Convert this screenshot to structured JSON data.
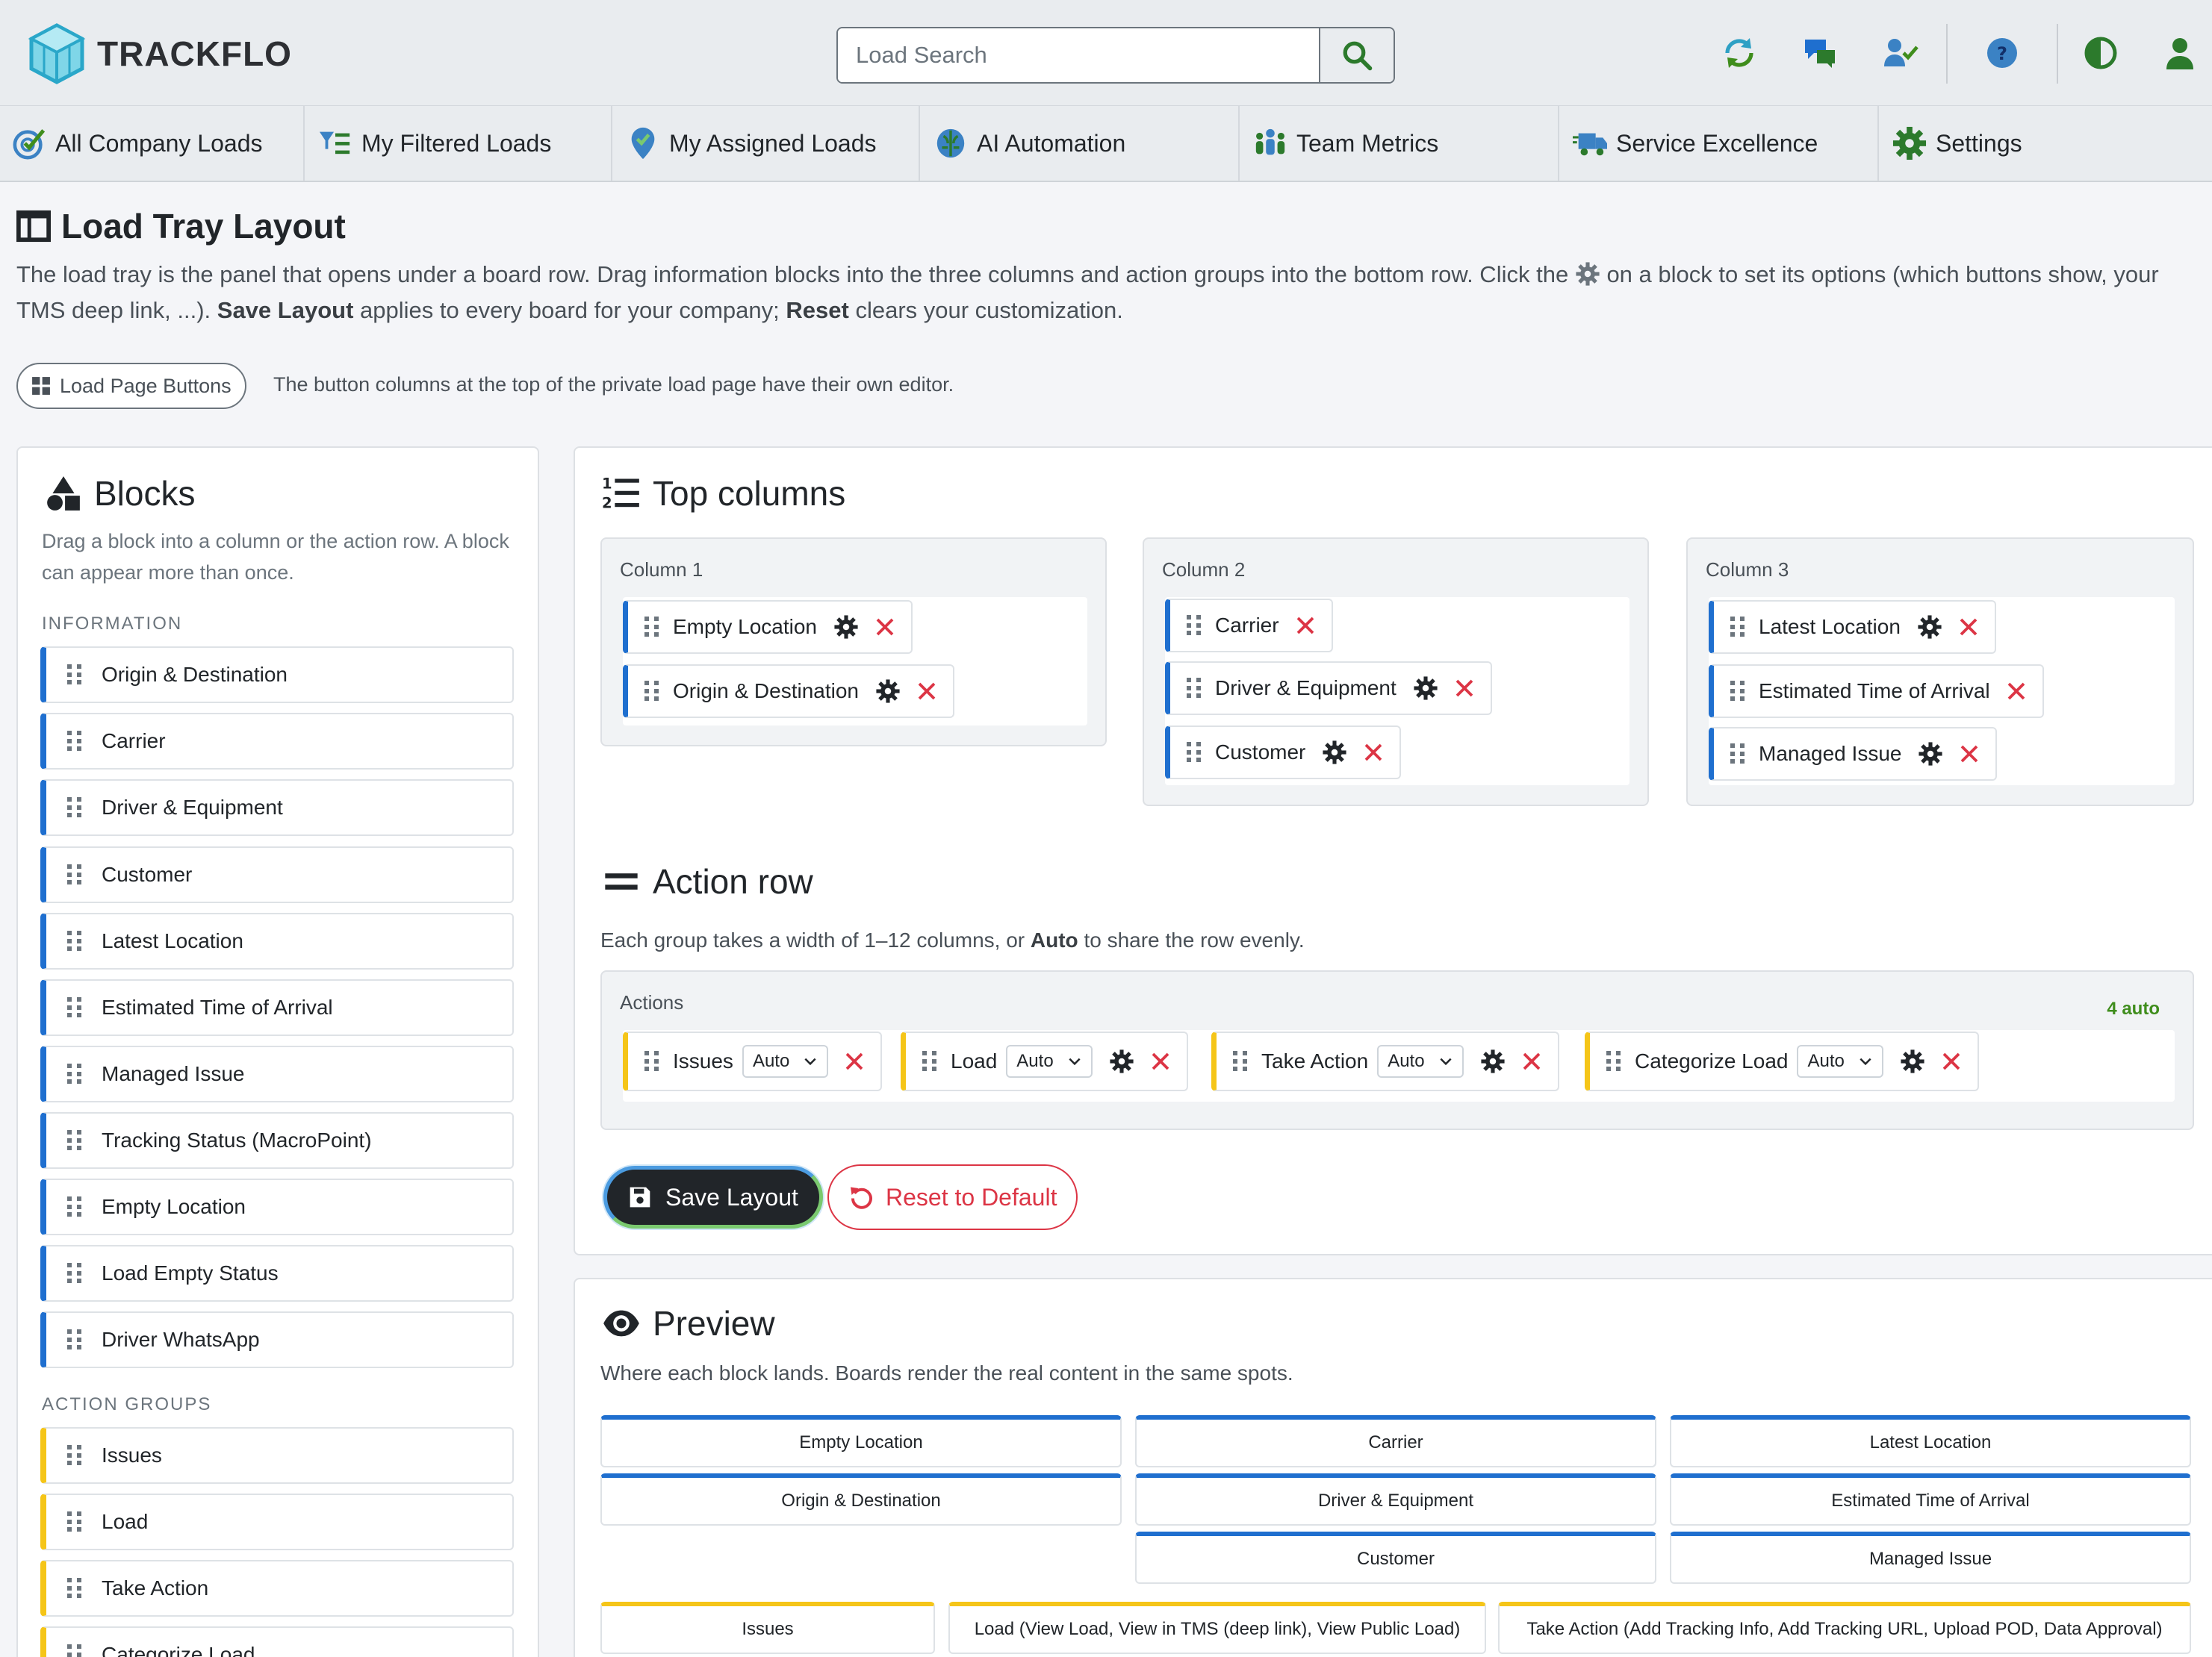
{
  "app": {
    "name": "TRACKFLO"
  },
  "search": {
    "placeholder": "Load Search"
  },
  "header_icons": [
    "refresh-icon",
    "chat-icon",
    "user-check-icon",
    "help-icon",
    "contrast-icon",
    "user-icon"
  ],
  "nav": [
    {
      "label": "All Company Loads",
      "icon": "target-check-icon"
    },
    {
      "label": "My Filtered Loads",
      "icon": "filter-list-icon"
    },
    {
      "label": "My Assigned Loads",
      "icon": "map-pin-check-icon"
    },
    {
      "label": "AI Automation",
      "icon": "brain-icon"
    },
    {
      "label": "Team Metrics",
      "icon": "team-icon"
    },
    {
      "label": "Service Excellence",
      "icon": "truck-fast-icon"
    },
    {
      "label": "Settings",
      "icon": "gear-icon"
    }
  ],
  "page": {
    "title": "Load Tray Layout",
    "intro_1": "The load tray is the panel that opens under a board row. Drag information blocks into the three columns and action groups into the bottom row. Click the",
    "intro_2": "on a block to set its options (which buttons show, your TMS deep link, ...).",
    "intro_save": "Save Layout",
    "intro_3": "applies to every board for your company;",
    "intro_reset": "Reset",
    "intro_4": "clears your customization.",
    "load_page_buttons": "Load Page Buttons",
    "load_page_note": "The button columns at the top of the private load page have their own editor."
  },
  "blocks": {
    "title": "Blocks",
    "description": "Drag a block into a column or the action row. A block can appear more than once.",
    "information_label": "INFORMATION",
    "information": [
      "Origin & Destination",
      "Carrier",
      "Driver & Equipment",
      "Customer",
      "Latest Location",
      "Estimated Time of Arrival",
      "Managed Issue",
      "Tracking Status (MacroPoint)",
      "Empty Location",
      "Load Empty Status",
      "Driver WhatsApp"
    ],
    "action_groups_label": "ACTION GROUPS",
    "action_groups": [
      "Issues",
      "Load",
      "Take Action",
      "Categorize Load"
    ]
  },
  "top_columns": {
    "title": "Top columns",
    "columns": [
      {
        "label": "Column 1",
        "items": [
          "Empty Location",
          "Origin & Destination"
        ]
      },
      {
        "label": "Column 2",
        "items": [
          "Carrier",
          "Driver & Equipment",
          "Customer"
        ]
      },
      {
        "label": "Column 3",
        "items": [
          "Latest Location",
          "Estimated Time of Arrival",
          "Managed Issue"
        ]
      }
    ]
  },
  "action_row": {
    "title": "Action row",
    "desc_1": "Each group takes a width of 1–12 columns, or",
    "desc_auto": "Auto",
    "desc_2": "to share the row evenly.",
    "label": "Actions",
    "badge": "4 auto",
    "items": [
      {
        "name": "Issues",
        "width": "Auto"
      },
      {
        "name": "Load",
        "width": "Auto"
      },
      {
        "name": "Take Action",
        "width": "Auto"
      },
      {
        "name": "Categorize Load",
        "width": "Auto"
      }
    ],
    "save_label": "Save Layout",
    "reset_label": "Reset to Default"
  },
  "preview": {
    "title": "Preview",
    "description": "Where each block lands. Boards render the real content in the same spots.",
    "col1": [
      "Empty Location",
      "Origin & Destination"
    ],
    "col2": [
      "Carrier",
      "Driver & Equipment",
      "Customer"
    ],
    "col3": [
      "Latest Location",
      "Estimated Time of Arrival",
      "Managed Issue"
    ],
    "actions": [
      "Issues",
      "Load (View Load, View in TMS (deep link), View Public Load)",
      "Take Action (Add Tracking Info, Add Tracking URL, Upload POD, Data Approval)"
    ]
  },
  "colors": {
    "accent_blue": "#1f6fcf",
    "action_yellow": "#f5c518",
    "danger": "#dc3545",
    "success": "#3f8d1c"
  }
}
